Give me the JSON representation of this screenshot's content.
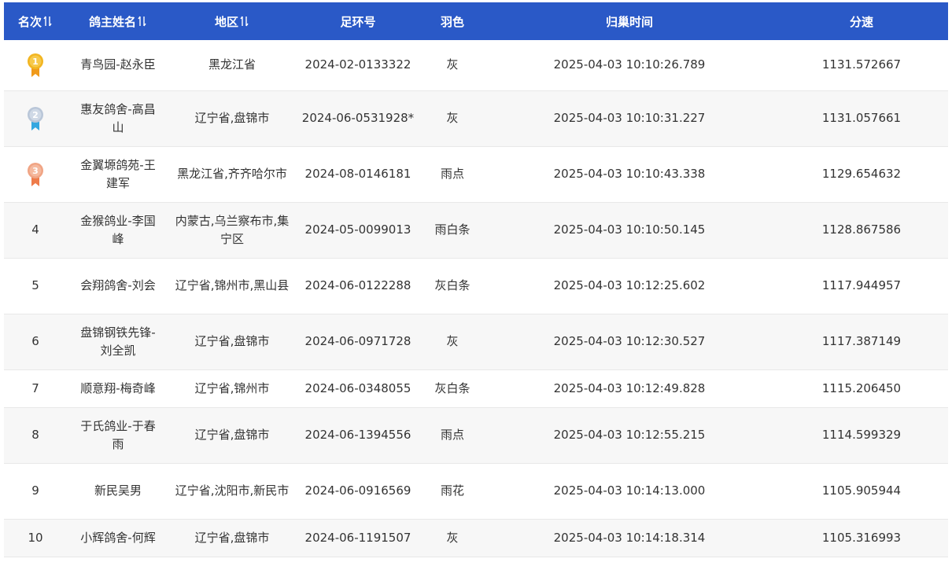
{
  "headers": [
    {
      "label": "名次",
      "sortable": true
    },
    {
      "label": "鸽主姓名",
      "sortable": true
    },
    {
      "label": "地区",
      "sortable": true
    },
    {
      "label": "足环号",
      "sortable": false
    },
    {
      "label": "羽色",
      "sortable": false
    },
    {
      "label": "归巢时间",
      "sortable": false
    },
    {
      "label": "分速",
      "sortable": false
    }
  ],
  "rows": [
    {
      "rank": "1",
      "name": "青鸟园-赵永臣",
      "region": "黑龙江省",
      "ring": "2024-02-0133322",
      "color": "灰",
      "time": "2025-04-03 10:10:26.789",
      "speed": "1131.572667"
    },
    {
      "rank": "2",
      "name": "惠友鸽舍-高昌山",
      "region": "辽宁省,盘锦市",
      "ring": "2024-06-0531928*",
      "color": "灰",
      "time": "2025-04-03 10:10:31.227",
      "speed": "1131.057661"
    },
    {
      "rank": "3",
      "name": "金翼塬鸽苑-王建军",
      "region": "黑龙江省,齐齐哈尔市",
      "ring": "2024-08-0146181",
      "color": "雨点",
      "time": "2025-04-03 10:10:43.338",
      "speed": "1129.654632"
    },
    {
      "rank": "4",
      "name": "金猴鸽业-李国峰",
      "region": "内蒙古,乌兰察布市,集宁区",
      "ring": "2024-05-0099013",
      "color": "雨白条",
      "time": "2025-04-03 10:10:50.145",
      "speed": "1128.867586"
    },
    {
      "rank": "5",
      "name": "会翔鸽舍-刘会",
      "region": "辽宁省,锦州市,黑山县",
      "ring": "2024-06-0122288",
      "color": "灰白条",
      "time": "2025-04-03 10:12:25.602",
      "speed": "1117.944957"
    },
    {
      "rank": "6",
      "name": "盘锦钢铁先锋-刘全凯",
      "region": "辽宁省,盘锦市",
      "ring": "2024-06-0971728",
      "color": "灰",
      "time": "2025-04-03 10:12:30.527",
      "speed": "1117.387149"
    },
    {
      "rank": "7",
      "name": "顺意翔-梅奇峰",
      "region": "辽宁省,锦州市",
      "ring": "2024-06-0348055",
      "color": "灰白条",
      "time": "2025-04-03 10:12:49.828",
      "speed": "1115.206450"
    },
    {
      "rank": "8",
      "name": "于氏鸽业-于春雨",
      "region": "辽宁省,盘锦市",
      "ring": "2024-06-1394556",
      "color": "雨点",
      "time": "2025-04-03 10:12:55.215",
      "speed": "1114.599329"
    },
    {
      "rank": "9",
      "name": "新民吴男",
      "region": "辽宁省,沈阳市,新民市",
      "ring": "2024-06-0916569",
      "color": "雨花",
      "time": "2025-04-03 10:14:13.000",
      "speed": "1105.905944"
    },
    {
      "rank": "10",
      "name": "小辉鸽舍-何辉",
      "region": "辽宁省,盘锦市",
      "ring": "2024-06-1191507",
      "color": "灰",
      "time": "2025-04-03 10:14:18.314",
      "speed": "1105.316993"
    }
  ],
  "medals": [
    {
      "rank": "1",
      "icon": "gold-medal-icon",
      "color": "#f2b521",
      "ribbon": "#f09a1a"
    },
    {
      "rank": "2",
      "icon": "silver-medal-icon",
      "color": "#b9c6d8",
      "ribbon": "#34a7e0"
    },
    {
      "rank": "3",
      "icon": "bronze-medal-icon",
      "color": "#f0a484",
      "ribbon": "#ee7b4a"
    }
  ],
  "colors": {
    "header_bg": "#2a59c7",
    "header_text": "#ffffff",
    "row_alt_bg": "#f7f7f7",
    "text": "#333333"
  }
}
